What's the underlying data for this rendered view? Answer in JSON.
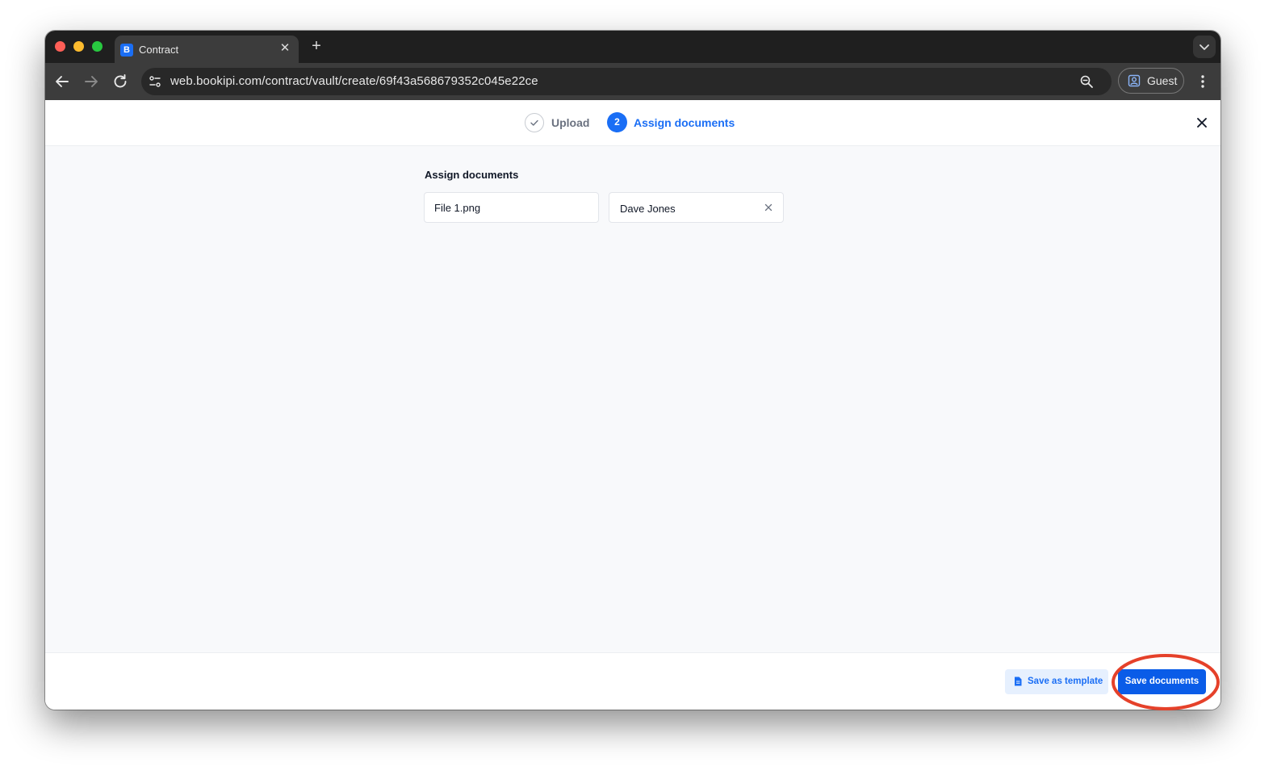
{
  "browser": {
    "tab_title": "Contract",
    "favicon_glyph": "B",
    "url": "web.bookipi.com/contract/vault/create/69f43a568679352c045e22ce",
    "profile_label": "Guest",
    "new_tab_glyph": "+",
    "tab_close_glyph": "✕"
  },
  "stepper": {
    "steps": [
      {
        "label": "Upload",
        "state": "done"
      },
      {
        "number": "2",
        "label": "Assign documents",
        "state": "active"
      }
    ]
  },
  "assign": {
    "section_title": "Assign documents",
    "file_name": "File 1.png",
    "assignee": "Dave Jones"
  },
  "footer": {
    "save_template_label": "Save as template",
    "save_documents_label": "Save documents"
  },
  "colors": {
    "accent": "#1a6ef5",
    "primary_button": "#0a5ce8",
    "annotation": "#e5412a"
  },
  "icons": [
    "back-arrow-icon",
    "forward-arrow-icon",
    "reload-icon",
    "site-info-icon",
    "zoom-icon",
    "profile-icon",
    "more-vert-icon",
    "check-icon",
    "close-icon",
    "clear-icon",
    "document-icon",
    "chevron-down-icon"
  ]
}
